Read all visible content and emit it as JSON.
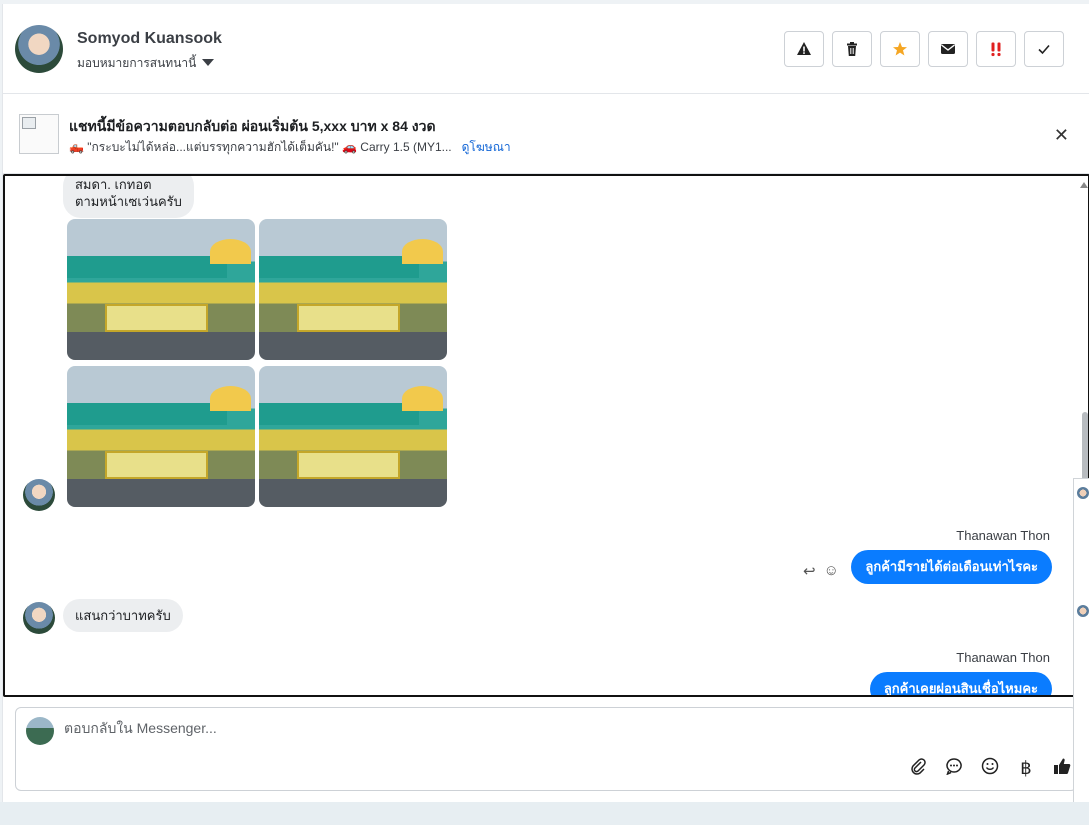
{
  "header": {
    "contact_name": "Somyod Kuansook",
    "assign_label": "มอบหมายการสนทนานี้",
    "toolbar": [
      {
        "icon": "warning-icon",
        "glyph": "⚠"
      },
      {
        "icon": "trash-icon",
        "glyph": "🗑"
      },
      {
        "icon": "star-icon",
        "glyph": "★",
        "color": "#f5a623"
      },
      {
        "icon": "mail-icon",
        "glyph": "✉"
      },
      {
        "icon": "priority-icon",
        "glyph": "‼",
        "color": "#e02020"
      },
      {
        "icon": "check-icon",
        "glyph": "✓"
      }
    ]
  },
  "ad": {
    "title": "แชทนี้มีข้อความตอบกลับต่อ ผ่อนเริ่มต้น 5,xxx บาท x 84 งวด",
    "subtitle": "🛻 \"กระบะไม่ได้หล่อ...แต่บรรทุกความฮักได้เต็มคัน!\" 🚗 Carry 1.5 (MY1...",
    "link": "ดูโฆษณา"
  },
  "chat": {
    "messages": [
      {
        "type": "in",
        "text_line1": "สมดา. เกทอต",
        "text_line2": "ตามหน้าเซเว่นครับ"
      },
      {
        "type": "photos",
        "count": 4
      },
      {
        "type": "out",
        "sender": "Thanawan Thon",
        "text": "ลูกค้ามีรายได้ต่อเดือนเท่าไรคะ"
      },
      {
        "type": "in",
        "text": "แสนกว่าบาทครับ"
      },
      {
        "type": "out",
        "sender": "Thanawan Thon",
        "text": "ลูกค้าเคยผ่อนสินเชื่อไหมคะ"
      }
    ]
  },
  "composer": {
    "placeholder": "ตอบกลับใน Messenger...",
    "icons": [
      "attachment-icon",
      "chat-icon",
      "emoji-icon",
      "baht-icon",
      "thumbs-up-icon"
    ],
    "baht_glyph": "฿"
  }
}
